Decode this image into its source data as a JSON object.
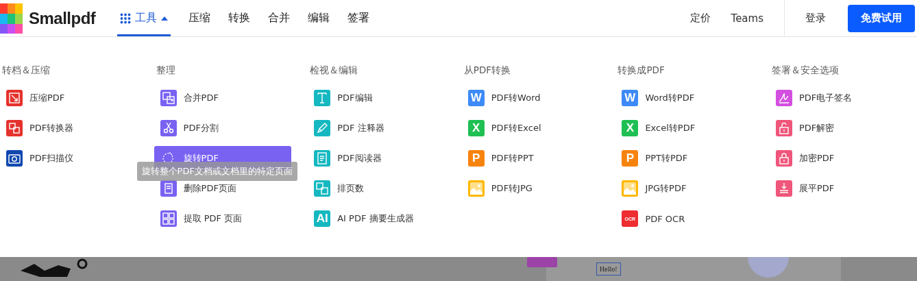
{
  "header": {
    "logo": "Smallpdf",
    "tools_tab": {
      "label": "工具",
      "selected": true,
      "expanded": true
    },
    "nav": [
      "压缩",
      "转换",
      "合并",
      "编辑",
      "签署"
    ],
    "right_links": [
      "定价",
      "Teams"
    ],
    "login": "登录",
    "cta": "免费试用"
  },
  "menu": {
    "columns": [
      {
        "heading": "转档＆压缩",
        "items": [
          {
            "label": "压缩PDF",
            "kind": "glyph",
            "color": "#e5322d",
            "selected": false
          },
          {
            "label": "PDF转换器",
            "kind": "glyph",
            "color": "#e5322d",
            "selected": false
          },
          {
            "label": "PDF扫描仪",
            "kind": "glyph",
            "color": "#0f47af",
            "selected": false
          }
        ]
      },
      {
        "heading": "整理",
        "items": [
          {
            "label": "合并PDF",
            "kind": "glyph",
            "color": "#7961f2",
            "selected": false
          },
          {
            "label": "PDF分割",
            "kind": "glyph",
            "color": "#7961f2",
            "selected": false
          },
          {
            "label": "旋转PDF",
            "kind": "glyph",
            "color": "#7961f2",
            "selected": true,
            "tooltip": "旋转整个PDF文档或文档里的特定页面"
          },
          {
            "label": "删除PDF页面",
            "kind": "glyph",
            "color": "#7961f2",
            "selected": false
          },
          {
            "label": "提取 PDF 页面",
            "kind": "glyph",
            "color": "#7961f2",
            "selected": false
          }
        ]
      },
      {
        "heading": "检视＆编辑",
        "items": [
          {
            "label": "PDF编辑",
            "kind": "glyph",
            "color": "#15b8c0",
            "selected": false
          },
          {
            "label": "PDF 注释器",
            "kind": "glyph",
            "color": "#15b8c0",
            "selected": false
          },
          {
            "label": "PDF阅读器",
            "kind": "glyph",
            "color": "#15b8c0",
            "selected": false
          },
          {
            "label": "排页数",
            "kind": "glyph",
            "color": "#15b8c0",
            "selected": false
          },
          {
            "label": "AI PDF 摘要生成器",
            "kind": "letter",
            "badge": "AI",
            "color": "#15b8c0",
            "selected": false
          }
        ]
      },
      {
        "heading": "从PDF转换",
        "items": [
          {
            "label": "PDF转Word",
            "kind": "letter",
            "badge": "W",
            "color": "#3d8af7",
            "selected": false
          },
          {
            "label": "PDF转Excel",
            "kind": "letter",
            "badge": "X",
            "color": "#1fc053",
            "selected": false
          },
          {
            "label": "PDF转PPT",
            "kind": "letter",
            "badge": "P",
            "color": "#f7830f",
            "selected": false
          },
          {
            "label": "PDF转JPG",
            "kind": "glyph",
            "color": "#ffb700",
            "selected": false
          }
        ]
      },
      {
        "heading": "转换成PDF",
        "items": [
          {
            "label": "Word转PDF",
            "kind": "letter",
            "badge": "W",
            "color": "#3d8af7",
            "selected": false
          },
          {
            "label": "Excel转PDF",
            "kind": "letter",
            "badge": "X",
            "color": "#1fc053",
            "selected": false
          },
          {
            "label": "PPT转PDF",
            "kind": "letter",
            "badge": "P",
            "color": "#f7830f",
            "selected": false
          },
          {
            "label": "JPG转PDF",
            "kind": "glyph",
            "color": "#ffb700",
            "selected": false
          },
          {
            "label": "PDF OCR",
            "kind": "letter",
            "badge": "OCR",
            "color": "#ee2e31",
            "selected": false
          }
        ]
      },
      {
        "heading": "签署＆安全选项",
        "items": [
          {
            "label": "PDF电子签名",
            "kind": "glyph",
            "color": "#d34fe0",
            "selected": false
          },
          {
            "label": "PDF解密",
            "kind": "glyph",
            "color": "#f0557a",
            "selected": false
          },
          {
            "label": "加密PDF",
            "kind": "glyph",
            "color": "#f0557a",
            "selected": false
          },
          {
            "label": "展平PDF",
            "kind": "glyph",
            "color": "#f0557a",
            "selected": false
          }
        ]
      }
    ]
  },
  "backdrop": {
    "text_box": "Hello!"
  }
}
